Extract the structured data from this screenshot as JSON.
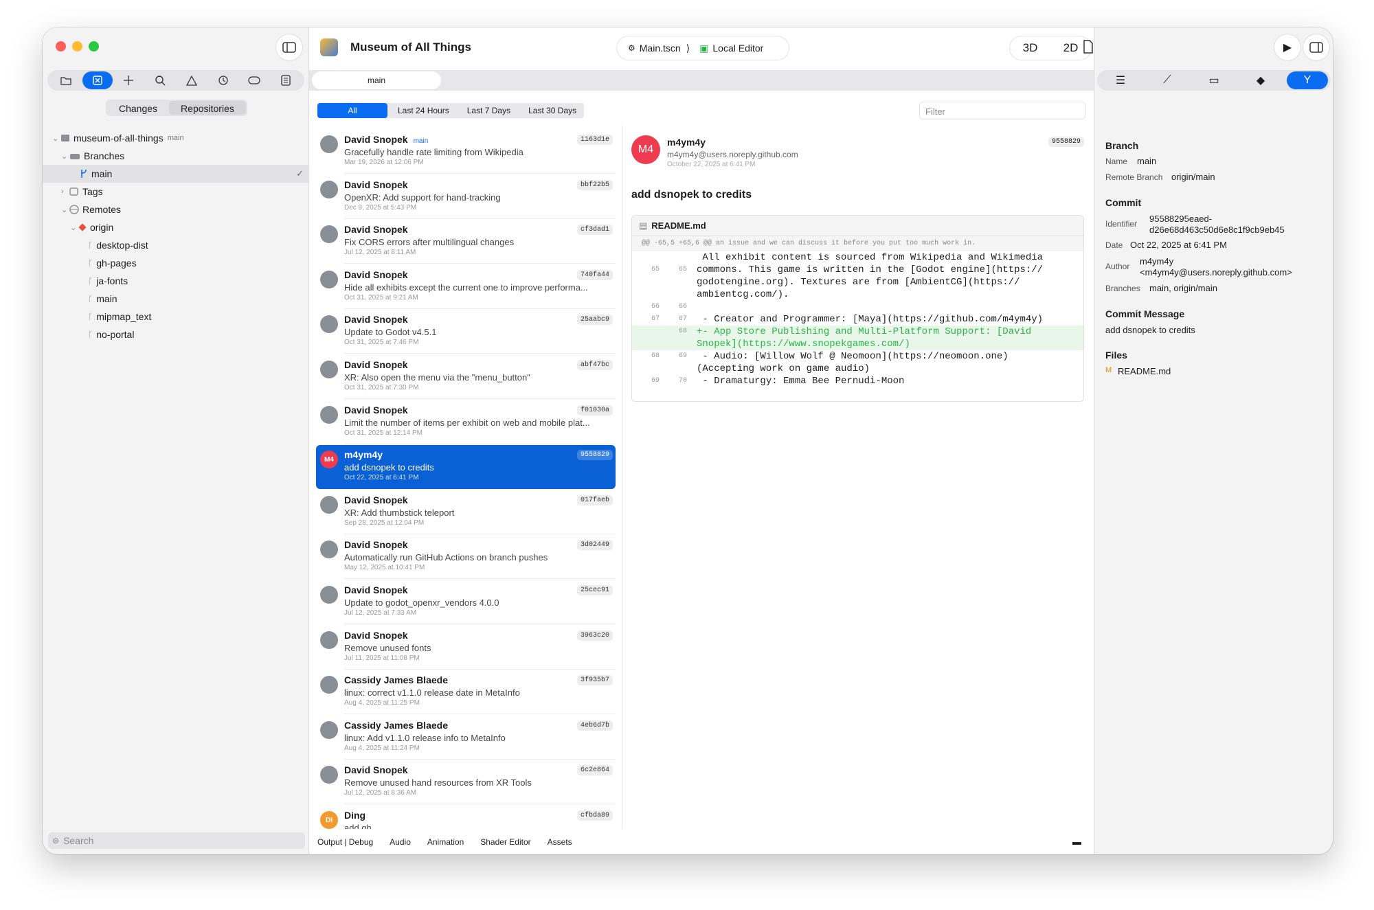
{
  "colors": {
    "accent": "#0a6cf0",
    "close": "#ff5f57",
    "minimize": "#febc2e",
    "zoom": "#28c840",
    "added": "#2bb34a"
  },
  "project": {
    "title": "Museum of All Things",
    "scene": "Main.tscn",
    "editor": "Local Editor",
    "mode3d": "3D",
    "mode2d": "2D"
  },
  "sidebar": {
    "tab_changes": "Changes",
    "tab_repos": "Repositories",
    "search": "Search",
    "repo": "museum-of-all-things",
    "repo_branch": "main",
    "branches": "Branches",
    "current": "main",
    "tags": "Tags",
    "remotes": "Remotes",
    "origin": "origin",
    "remote_branches": [
      "desktop-dist",
      "gh-pages",
      "ja-fonts",
      "main",
      "mipmap_text",
      "no-portal"
    ]
  },
  "editor_tab": "main",
  "filters": [
    "All",
    "Last 24 Hours",
    "Last 7 Days",
    "Last 30 Days"
  ],
  "filter_placeholder": "Filter",
  "branch_badge": "main",
  "commits": [
    {
      "author": "David Snopek",
      "msg": "Gracefully handle rate limiting from Wikipedia",
      "date": "Mar 19, 2026 at 12:06 PM",
      "hash": "1163d1e"
    },
    {
      "author": "David Snopek",
      "msg": "OpenXR: Add support for hand-tracking",
      "date": "Dec 9, 2025 at 5:43 PM",
      "hash": "bbf22b5"
    },
    {
      "author": "David Snopek",
      "msg": "Fix CORS errors after multilingual changes",
      "date": "Jul 12, 2025 at 8:11 AM",
      "hash": "cf3dad1"
    },
    {
      "author": "David Snopek",
      "msg": "Hide all exhibits except the current one to improve performa...",
      "date": "Oct 31, 2025 at 9:21 AM",
      "hash": "740fa44"
    },
    {
      "author": "David Snopek",
      "msg": "Update to Godot v4.5.1",
      "date": "Oct 31, 2025 at 7:46 PM",
      "hash": "25aabc9"
    },
    {
      "author": "David Snopek",
      "msg": "XR: Also open the menu via the \"menu_button\"",
      "date": "Oct 31, 2025 at 7:30 PM",
      "hash": "abf47bc"
    },
    {
      "author": "David Snopek",
      "msg": "Limit the number of items per exhibit on web and mobile plat...",
      "date": "Oct 31, 2025 at 12:14 PM",
      "hash": "f01030a"
    },
    {
      "author": "m4ym4y",
      "msg": "add dsnopek to credits",
      "date": "Oct 22, 2025 at 6:41 PM",
      "hash": "9558829",
      "initials": "M4"
    },
    {
      "author": "David Snopek",
      "msg": "XR: Add thumbstick teleport",
      "date": "Sep 28, 2025 at 12:04 PM",
      "hash": "017faeb"
    },
    {
      "author": "David Snopek",
      "msg": "Automatically run GitHub Actions on branch pushes",
      "date": "May 12, 2025 at 10:41 PM",
      "hash": "3d02449"
    },
    {
      "author": "David Snopek",
      "msg": "Update to godot_openxr_vendors 4.0.0",
      "date": "Jul 12, 2025 at 7:33 AM",
      "hash": "25cec91"
    },
    {
      "author": "David Snopek",
      "msg": "Remove unused fonts",
      "date": "Jul 11, 2025 at 11:08 PM",
      "hash": "3963c20"
    },
    {
      "author": "Cassidy James Blaede",
      "msg": "linux: correct v1.1.0 release date in MetaInfo",
      "date": "Aug 4, 2025 at 11:25 PM",
      "hash": "3f935b7"
    },
    {
      "author": "Cassidy James Blaede",
      "msg": "linux: Add v1.1.0 release info to MetaInfo",
      "date": "Aug 4, 2025 at 11:24 PM",
      "hash": "4eb6d7b"
    },
    {
      "author": "David Snopek",
      "msg": "Remove unused hand resources from XR Tools",
      "date": "Jul 12, 2025 at 8:36 AM",
      "hash": "6c2e864"
    },
    {
      "author": "Ding",
      "msg": "add gh...",
      "date": "",
      "hash": "cfbda89",
      "initials": "DI"
    }
  ],
  "detail": {
    "initials": "M4",
    "author": "m4ym4y",
    "email": "m4ym4y@users.noreply.github.com",
    "date": "October 22, 2025 at 6:41 PM",
    "hash": "9558829",
    "title": "add dsnopek to credits",
    "file": "README.md",
    "hunk": "@@ -65,5 +65,6 @@ an issue and we can discuss it before you put too much work in.",
    "lines": [
      {
        "a": "",
        "b": "",
        "t": " All exhibit content is sourced from Wikipedia and Wikimedia"
      },
      {
        "a": "65",
        "b": "65",
        "t": "commons. This game is written in the [Godot engine](https://"
      },
      {
        "a": "",
        "b": "",
        "t": "godotengine.org). Textures are from [AmbientCG](https://"
      },
      {
        "a": "",
        "b": "",
        "t": "ambientcg.com/)."
      },
      {
        "a": "66",
        "b": "66",
        "t": ""
      },
      {
        "a": "67",
        "b": "67",
        "t": " - Creator and Programmer: [Maya](https://github.com/m4ym4y)"
      },
      {
        "a": "",
        "b": "68",
        "t": "+- App Store Publishing and Multi-Platform Support: [David",
        "add": true
      },
      {
        "a": "",
        "b": "",
        "t": "Snopek](https://www.snopekgames.com/)",
        "add": true
      },
      {
        "a": "68",
        "b": "69",
        "t": " - Audio: [Willow Wolf @ Neomoon](https://neomoon.one)"
      },
      {
        "a": "",
        "b": "",
        "t": "(Accepting work on game audio)"
      },
      {
        "a": "69",
        "b": "70",
        "t": " - Dramaturgy: Emma Bee Pernudi-Moon"
      }
    ]
  },
  "inspector": {
    "branch_h": "Branch",
    "name_k": "Name",
    "name_v": "main",
    "remote_k": "Remote Branch",
    "remote_v": "origin/main",
    "commit_h": "Commit",
    "id_k": "Identifier",
    "id_v1": "95588295eaed-",
    "id_v2": "d26e68d463c50d6e8c1f9cb9eb45",
    "date_k": "Date",
    "date_v": "Oct 22, 2025 at 6:41 PM",
    "author_k": "Author",
    "author_v1": "m4ym4y",
    "author_v2": "<m4ym4y@users.noreply.github.com>",
    "branches_k": "Branches",
    "branches_v": "main, origin/main",
    "msg_h": "Commit Message",
    "msg_v": "add dsnopek to credits",
    "files_h": "Files",
    "file_status": "M",
    "file_v": "README.md"
  },
  "bottom": [
    "Output | Debug",
    "Audio",
    "Animation",
    "Shader Editor",
    "Assets"
  ]
}
